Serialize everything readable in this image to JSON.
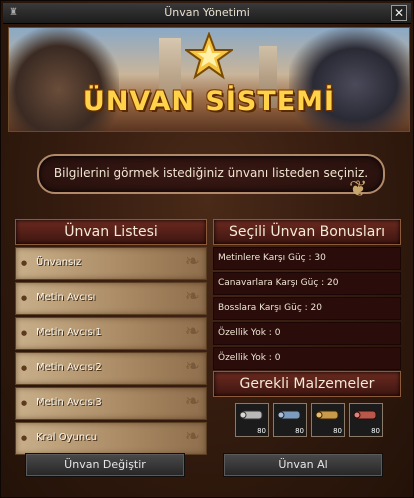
{
  "window": {
    "title": "Ünvan Yönetimi",
    "close_label": "✕"
  },
  "banner": {
    "title": "ÜNVAN SİSTEMİ"
  },
  "info": {
    "text": "Bilgilerini görmek istediğiniz ünvanı listeden seçiniz."
  },
  "title_list": {
    "header": "Ünvan Listesi",
    "items": [
      "Ünvansız",
      "Metin Avcısı",
      "Metin Avcısı1",
      "Metin Avcısı2",
      "Metin Avcısı3",
      "Kral Oyuncu"
    ]
  },
  "bonuses": {
    "header": "Seçili Ünvan Bonusları",
    "rows": [
      "Metinlere Karşı Güç : 30",
      "Canavarlara Karşı Güç : 20",
      "Bosslara Karşı Güç : 20",
      "Özellik Yok : 0",
      "Özellik Yok : 0"
    ]
  },
  "materials": {
    "header": "Gerekli Malzemeler",
    "items": [
      {
        "icon": "scroll-gray-icon",
        "qty": "80",
        "color": "#b9b9b9"
      },
      {
        "icon": "scroll-blue-icon",
        "qty": "80",
        "color": "#7c9bbf"
      },
      {
        "icon": "scroll-gold-icon",
        "qty": "80",
        "color": "#c99a4a"
      },
      {
        "icon": "scroll-red-icon",
        "qty": "80",
        "color": "#b9574a"
      }
    ]
  },
  "buttons": {
    "change": "Ünvan Değiştir",
    "get": "Ünvan Al"
  }
}
